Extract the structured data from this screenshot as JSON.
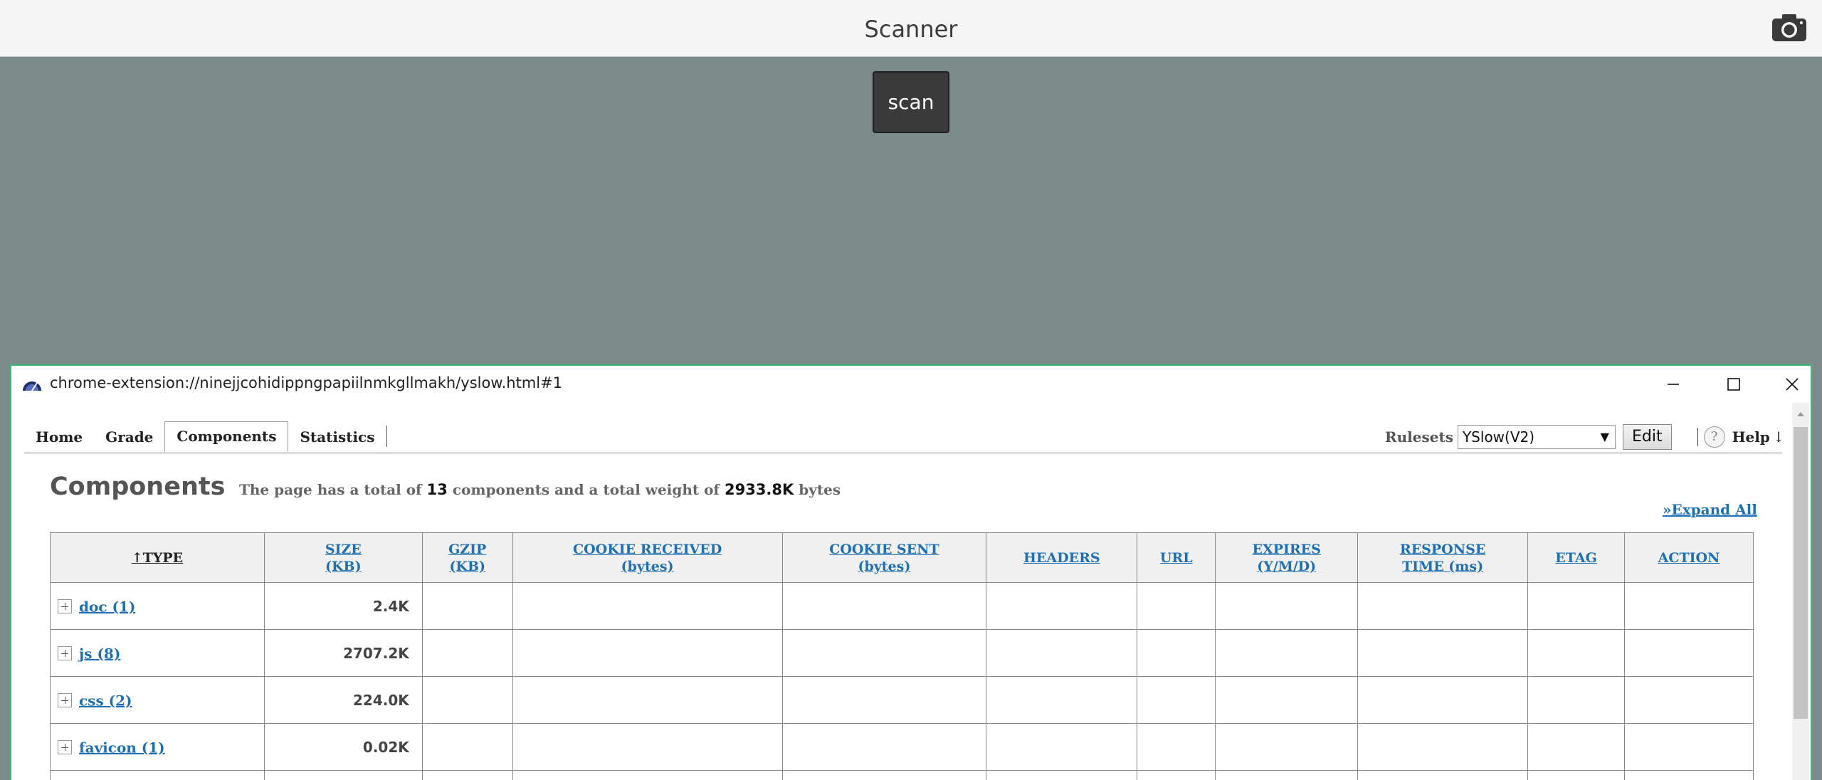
{
  "app": {
    "title": "Scanner",
    "scan_label": "scan"
  },
  "window": {
    "url": "chrome-extension://ninejjcohidippngpapiilnmkgllmakh/yslow.html#1"
  },
  "tabs": [
    {
      "label": "Home"
    },
    {
      "label": "Grade"
    },
    {
      "label": "Components",
      "active": true
    },
    {
      "label": "Statistics"
    }
  ],
  "toolbar": {
    "rulesets_label": "Rulesets",
    "rulesets_value": "YSlow(V2)",
    "edit_label": "Edit",
    "help_label": "Help",
    "help_arrow": "↓",
    "help_icon_glyph": "?"
  },
  "components": {
    "heading": "Components",
    "summary_pre": "The page has a total of",
    "total_components": "13",
    "summary_mid": "components and a total weight of",
    "total_weight": "2933.8K",
    "summary_post": "bytes",
    "expand_all": "»Expand All"
  },
  "table": {
    "headers": [
      {
        "line1": "↑TYPE",
        "line2": ""
      },
      {
        "line1": "SIZE",
        "line2": "(KB)"
      },
      {
        "line1": "GZIP",
        "line2": "(KB)"
      },
      {
        "line1": "COOKIE RECEIVED",
        "line2": "(bytes)"
      },
      {
        "line1": "COOKIE SENT",
        "line2": "(bytes)"
      },
      {
        "line1": "HEADERS",
        "line2": ""
      },
      {
        "line1": "URL",
        "line2": ""
      },
      {
        "line1": "EXPIRES",
        "line2": "(Y/M/D)"
      },
      {
        "line1": "RESPONSE",
        "line2": "TIME (ms)"
      },
      {
        "line1": "ETAG",
        "line2": ""
      },
      {
        "line1": "ACTION",
        "line2": ""
      }
    ],
    "rows": [
      {
        "type": "doc (1)",
        "size": "2.4K"
      },
      {
        "type": "js (8)",
        "size": "2707.2K"
      },
      {
        "type": "css (2)",
        "size": "224.0K"
      },
      {
        "type": "favicon (1)",
        "size": "0.02K"
      },
      {
        "type": "",
        "size": ""
      }
    ]
  },
  "colors": {
    "accent": "#1e6fb3",
    "window_border": "#3cb878",
    "backdrop": "#7c8a8a"
  },
  "icons": [
    "camera-icon",
    "yslow-logo-icon",
    "minimize-icon",
    "maximize-icon",
    "close-icon",
    "help-icon",
    "scroll-up-icon",
    "expand-icon"
  ]
}
